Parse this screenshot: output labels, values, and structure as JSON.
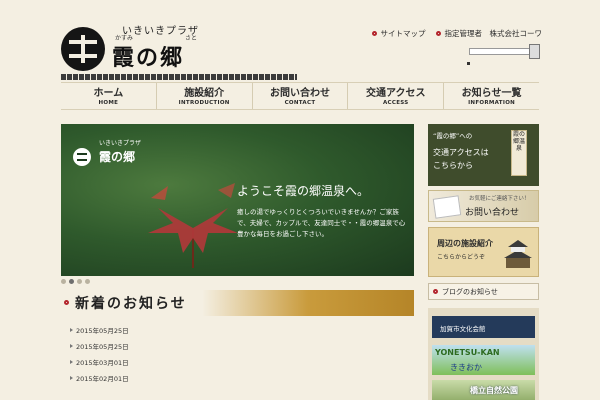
{
  "logo": {
    "subtitle": "いきいきプラザ",
    "ruby": [
      "かすみ",
      "さと"
    ],
    "title": "霞の郷"
  },
  "toplinks": {
    "sitemap": "サイトマップ",
    "manager": "指定管理者　株式会社コーワ"
  },
  "nav": [
    {
      "jp": "ホーム",
      "en": "HOME"
    },
    {
      "jp": "施設紹介",
      "en": "INTRODUCTION"
    },
    {
      "jp": "お問い合わせ",
      "en": "CONTACT"
    },
    {
      "jp": "交通アクセス",
      "en": "ACCESS"
    },
    {
      "jp": "お知らせ一覧",
      "en": "INFORMATION"
    }
  ],
  "hero": {
    "badge_sub": "いきいきプラザ",
    "badge_name": "霞の郷",
    "welcome": "ようこそ霞の郷温泉へ。",
    "copy": "癒しの湯でゆっくりとくつろいでいきませんか？ご家族で、夫婦で、カップルで、友達同士で・・霞の郷温泉で心豊かな毎日をお過ごし下さい。"
  },
  "news": {
    "heading": "新着のお知らせ",
    "items": [
      {
        "date": "2015年05月25日"
      },
      {
        "date": "2015年05月25日"
      },
      {
        "date": "2015年03月01日"
      },
      {
        "date": "2015年02月01日"
      }
    ]
  },
  "sidebar": {
    "access": {
      "line1": "“霞の郷”への",
      "line2a": "交通アクセスは",
      "line2b": "こちらから",
      "sign": "霞の郷温泉"
    },
    "contact": {
      "small": "お気軽にご連絡下さい！",
      "label": "お問い合わせ"
    },
    "facilities": {
      "label": "周辺の施設紹介",
      "sub": "こちらからどうぞ"
    },
    "blog": "ブログのお知らせ",
    "links": {
      "culture": "加賀市文化会館",
      "kan_a": "YONETSU-KAN",
      "kan_b": "ききおか",
      "park": "橋立自然公園"
    }
  }
}
